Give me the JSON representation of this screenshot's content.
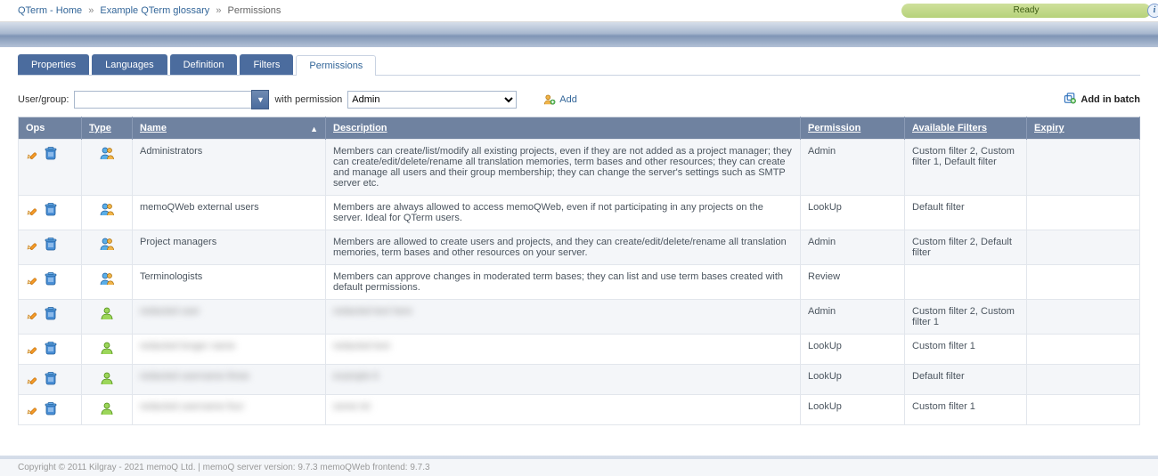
{
  "breadcrumbs": {
    "home": "QTerm - Home",
    "glossary": "Example QTerm glossary",
    "current": "Permissions"
  },
  "status": "Ready",
  "tabs": {
    "properties": "Properties",
    "languages": "Languages",
    "definition": "Definition",
    "filters": "Filters",
    "permissions": "Permissions"
  },
  "filter": {
    "user_label": "User/group:",
    "user_value": "",
    "with_label": "with permission",
    "perm_value": "Admin",
    "add_label": "Add",
    "batch_label": "Add in batch"
  },
  "headers": {
    "ops": "Ops",
    "type": "Type",
    "name": "Name",
    "description": "Description",
    "permission": "Permission",
    "filters": "Available Filters",
    "expiry": "Expiry"
  },
  "rows": [
    {
      "type": "group",
      "name": "Administrators",
      "description": "Members can create/list/modify all existing projects, even if they are not added as a project manager; they can create/edit/delete/rename all translation memories, term bases and other resources; they can create and manage all users and their group membership; they can change the server's settings such as SMTP server etc.",
      "permission": "Admin",
      "filters": "Custom filter 2, Custom filter 1, Default filter",
      "expiry": "",
      "blur": false
    },
    {
      "type": "group",
      "name": "memoQWeb external users",
      "description": "Members are always allowed to access memoQWeb, even if not participating in any projects on the server. Ideal for QTerm users.",
      "permission": "LookUp",
      "filters": "Default filter",
      "expiry": "",
      "blur": false
    },
    {
      "type": "group",
      "name": "Project managers",
      "description": "Members are allowed to create users and projects, and they can create/edit/delete/rename all translation memories, term bases and other resources on your server.",
      "permission": "Admin",
      "filters": "Custom filter 2, Default filter",
      "expiry": "",
      "blur": false
    },
    {
      "type": "group",
      "name": "Terminologists",
      "description": "Members can approve changes in moderated term bases; they can list and use term bases created with default permissions.",
      "permission": "Review",
      "filters": "",
      "expiry": "",
      "blur": false
    },
    {
      "type": "user",
      "name": "redacted user",
      "description": "redacted text here",
      "permission": "Admin",
      "filters": "Custom filter 2, Custom filter 1",
      "expiry": "",
      "blur": true
    },
    {
      "type": "user",
      "name": "redacted longer name",
      "description": "redacted text",
      "permission": "LookUp",
      "filters": "Custom filter 1",
      "expiry": "",
      "blur": true
    },
    {
      "type": "user",
      "name": "redacted username three",
      "description": "example tt",
      "permission": "LookUp",
      "filters": "Default filter",
      "expiry": "",
      "blur": true
    },
    {
      "type": "user",
      "name": "redacted username four",
      "description": "some txt",
      "permission": "LookUp",
      "filters": "Custom filter 1",
      "expiry": "",
      "blur": true
    }
  ],
  "footer": "Copyright © 2011 Kilgray - 2021 memoQ Ltd. | memoQ server version: 9.7.3 memoQWeb frontend: 9.7.3"
}
